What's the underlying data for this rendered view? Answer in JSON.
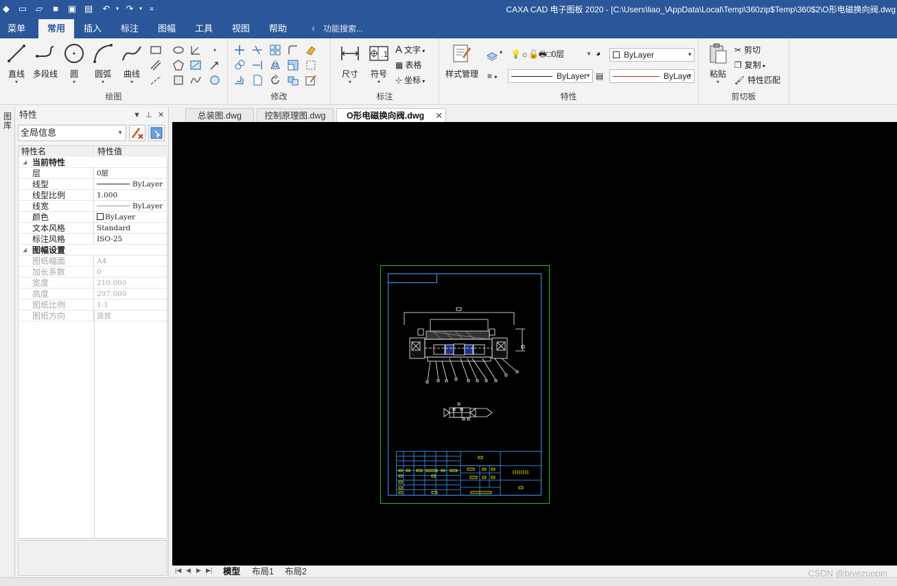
{
  "window": {
    "title": "CAXA CAD 电子图板 2020 - [C:\\Users\\liao_\\AppData\\Local\\Temp\\360zip$Temp\\360$2\\O形电磁换向阀.dwg"
  },
  "menu": {
    "tabs": [
      "菜单",
      "常用",
      "插入",
      "标注",
      "图幅",
      "工具",
      "视图",
      "帮助"
    ],
    "active": "常用",
    "search_placeholder": "功能搜索..."
  },
  "ribbon": {
    "draw": {
      "label": "绘图",
      "tools": [
        "直线",
        "多段线",
        "圆",
        "圆弧",
        "曲线"
      ]
    },
    "modify": {
      "label": "修改"
    },
    "annotate": {
      "label": "标注",
      "tools": [
        "尺寸",
        "符号"
      ],
      "small": [
        "文字",
        "表格",
        "坐标"
      ]
    },
    "properties": {
      "label": "特性",
      "style_manage": "样式管理",
      "layer_value": "0层",
      "color_value": "ByLayer",
      "linetype_value": "ByLayer",
      "lineweight_value": "ByLaye"
    },
    "clipboard": {
      "label": "剪切板",
      "paste": "粘贴",
      "cut": "剪切",
      "copy": "复制",
      "match": "特性匹配"
    }
  },
  "side_strip": {
    "label": "图库"
  },
  "properties_panel": {
    "title": "特性",
    "scope": "全局信息",
    "columns": [
      "特性名",
      "特性值"
    ],
    "sections": [
      {
        "name": "当前特性",
        "rows": [
          {
            "k": "层",
            "v": "0层"
          },
          {
            "k": "线型",
            "v": "ByLayer"
          },
          {
            "k": "线型比例",
            "v": "1.000"
          },
          {
            "k": "线宽",
            "v": "ByLayer"
          },
          {
            "k": "颜色",
            "v": "ByLayer"
          },
          {
            "k": "文本风格",
            "v": "Standard"
          },
          {
            "k": "标注风格",
            "v": "ISO-25"
          }
        ]
      },
      {
        "name": "图幅设置",
        "rows": [
          {
            "k": "图纸幅面",
            "v": "A4"
          },
          {
            "k": "加长系数",
            "v": "0"
          },
          {
            "k": "宽度",
            "v": "210.000"
          },
          {
            "k": "高度",
            "v": "297.000"
          },
          {
            "k": "图纸比例",
            "v": "1:1"
          },
          {
            "k": "图纸方向",
            "v": "竖放"
          }
        ]
      }
    ]
  },
  "documents": {
    "tabs": [
      "总装图.dwg",
      "控制原理图.dwg",
      "O形电磁换向阀.dwg"
    ],
    "active_index": 2
  },
  "layouts": {
    "tabs": [
      "模型",
      "布局1",
      "布局2"
    ],
    "active": "模型"
  },
  "watermark": "CSDN @biyezuopin",
  "colors": {
    "accent": "#2b579a",
    "canvas": "#000000",
    "frame_outer": "#21c321",
    "frame_inner": "#3aa0ff"
  }
}
